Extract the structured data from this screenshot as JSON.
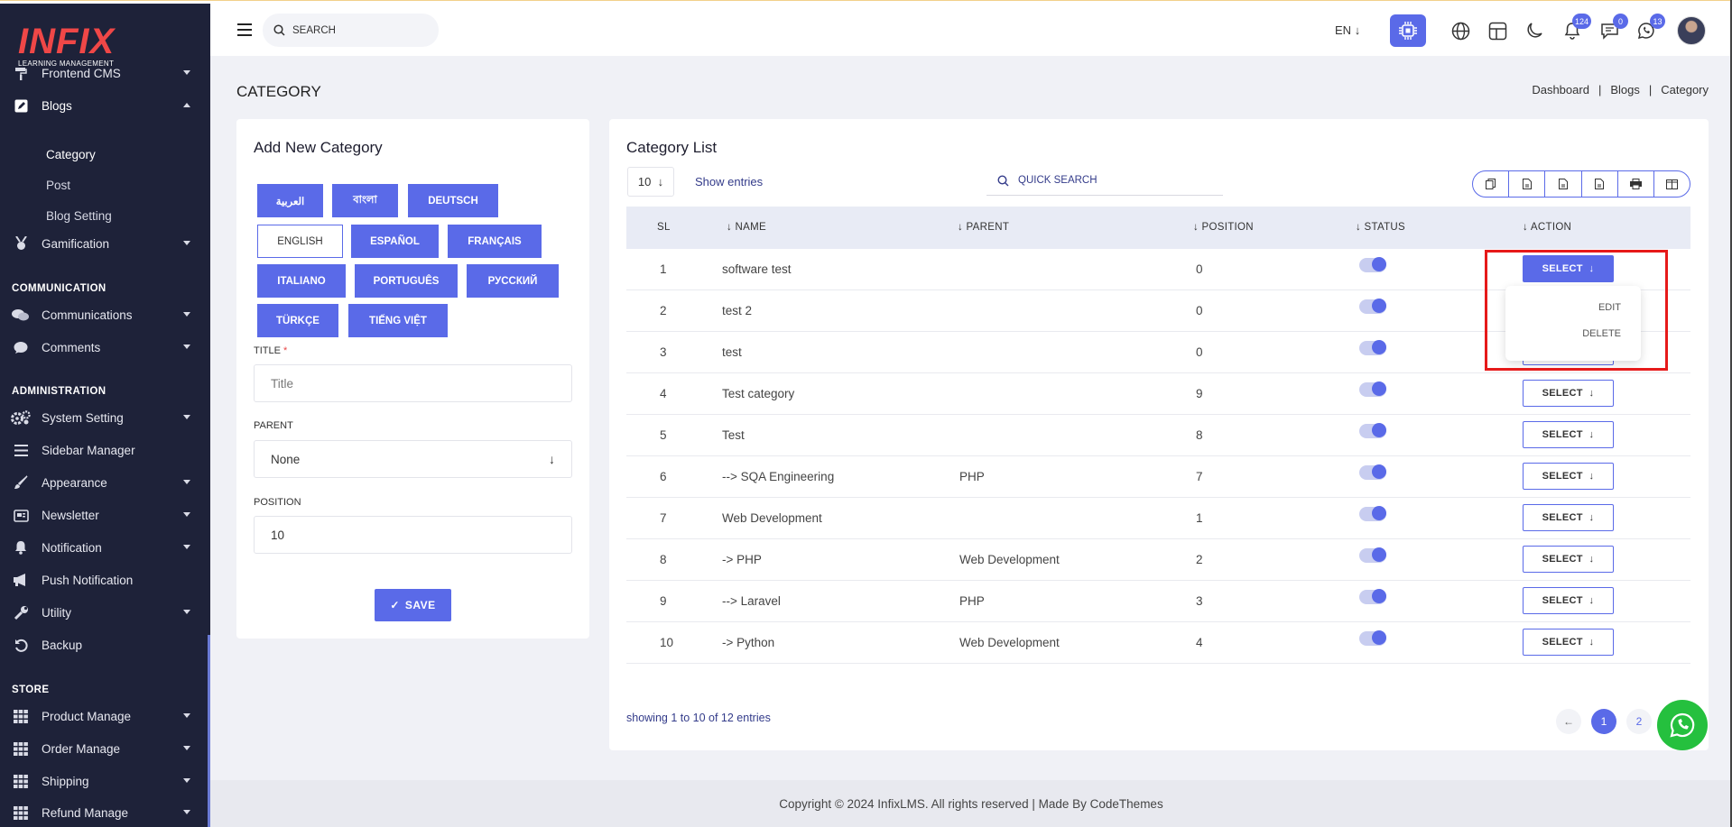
{
  "brand": {
    "logo_text": "INFIX",
    "logo_sub": "LEARNING MANAGEMENT"
  },
  "header": {
    "search_placeholder": "SEARCH",
    "language": "EN",
    "badges": {
      "notifications": "124",
      "messages": "0",
      "whatsapp": "13"
    }
  },
  "sidebar": {
    "items": [
      {
        "label": "Frontend CMS",
        "icon": "paint-roller-icon"
      },
      {
        "label": "Blogs",
        "icon": "edit-square-icon"
      },
      {
        "label": "Gamification",
        "icon": "medal-icon"
      },
      {
        "label": "Communications",
        "icon": "chat-bubbles-icon"
      },
      {
        "label": "Comments",
        "icon": "comment-icon"
      },
      {
        "label": "System Setting",
        "icon": "gears-icon"
      },
      {
        "label": "Sidebar Manager",
        "icon": "list-icon"
      },
      {
        "label": "Appearance",
        "icon": "brush-icon"
      },
      {
        "label": "Newsletter",
        "icon": "newsletter-icon"
      },
      {
        "label": "Notification",
        "icon": "bell-icon"
      },
      {
        "label": "Push Notification",
        "icon": "megaphone-icon"
      },
      {
        "label": "Utility",
        "icon": "wrench-icon"
      },
      {
        "label": "Backup",
        "icon": "backup-icon"
      },
      {
        "label": "Product Manage",
        "icon": "grid-icon"
      },
      {
        "label": "Order Manage",
        "icon": "grid-icon"
      },
      {
        "label": "Shipping",
        "icon": "grid-icon"
      },
      {
        "label": "Refund Manage",
        "icon": "grid-icon"
      }
    ],
    "blog_sub": [
      "Category",
      "Post",
      "Blog Setting"
    ],
    "sections": {
      "communication": "COMMUNICATION",
      "administration": "ADMINISTRATION",
      "store": "STORE"
    }
  },
  "page": {
    "title": "CATEGORY",
    "breadcrumb": [
      "Dashboard",
      "|",
      "Blogs",
      "|",
      "Category"
    ]
  },
  "add_form": {
    "title": "Add New Category",
    "languages": [
      "العربية",
      "বাংলা",
      "DEUTSCH",
      "ENGLISH",
      "ESPAÑOL",
      "FRANÇAIS",
      "ITALIANO",
      "PORTUGUÊS",
      "РУССКИЙ",
      "TÜRKÇE",
      "TIẾNG VIỆT"
    ],
    "title_label": "TITLE",
    "required_mark": "*",
    "title_placeholder": "Title",
    "parent_label": "PARENT",
    "parent_value": "None",
    "position_label": "POSITION",
    "position_value": "10",
    "save_label": "SAVE"
  },
  "list": {
    "title": "Category List",
    "entries_value": "10",
    "show_entries": "Show entries",
    "quick_search_placeholder": "QUICK SEARCH",
    "columns": [
      "SL",
      "NAME",
      "PARENT",
      "POSITION",
      "STATUS",
      "ACTION"
    ],
    "rows": [
      {
        "sl": "1",
        "name": "software test",
        "parent": "",
        "position": "0"
      },
      {
        "sl": "2",
        "name": "test 2",
        "parent": "",
        "position": "0"
      },
      {
        "sl": "3",
        "name": "test",
        "parent": "",
        "position": "0"
      },
      {
        "sl": "4",
        "name": "Test category",
        "parent": "",
        "position": "9"
      },
      {
        "sl": "5",
        "name": "Test",
        "parent": "",
        "position": "8"
      },
      {
        "sl": "6",
        "name": "--> SQA Engineering",
        "parent": "PHP",
        "position": "7"
      },
      {
        "sl": "7",
        "name": "Web Development",
        "parent": "",
        "position": "1"
      },
      {
        "sl": "8",
        "name": "-> PHP",
        "parent": "Web Development",
        "position": "2"
      },
      {
        "sl": "9",
        "name": "--> Laravel",
        "parent": "PHP",
        "position": "3"
      },
      {
        "sl": "10",
        "name": "-> Python",
        "parent": "Web Development",
        "position": "4"
      }
    ],
    "select_label": "SELECT",
    "dropdown": [
      "EDIT",
      "DELETE"
    ],
    "showing": "showing 1 to 10 of 12 entries",
    "pages": [
      "1",
      "2"
    ]
  },
  "footer": {
    "text": "Copyright © 2024 InfixLMS. All rights reserved | Made By CodeThemes"
  },
  "colors": {
    "primary": "#5a6ae8",
    "sidebar": "#1e2239",
    "highlight": "#e61a1a",
    "whatsapp": "#25c03e"
  }
}
